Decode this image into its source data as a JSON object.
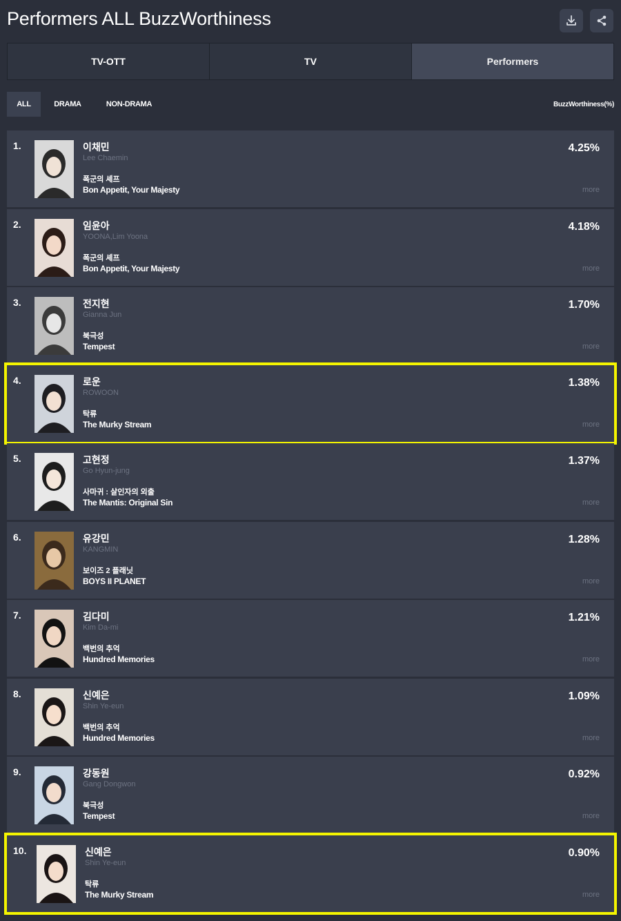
{
  "header": {
    "title": "Performers ALL BuzzWorthiness",
    "download_icon": "download-icon",
    "share_icon": "share-icon"
  },
  "tabs": [
    {
      "label": "TV-OTT",
      "active": false
    },
    {
      "label": "TV",
      "active": false
    },
    {
      "label": "Performers",
      "active": true
    }
  ],
  "filters": [
    {
      "label": "ALL",
      "active": true
    },
    {
      "label": "DRAMA",
      "active": false
    },
    {
      "label": "NON-DRAMA",
      "active": false
    }
  ],
  "column_label": "BuzzWorthiness(%)",
  "more_label": "more",
  "highlight_color": "#f5f500",
  "performers": [
    {
      "rank": "1.",
      "name_ko": "이채민",
      "name_en": "Lee Chaemin",
      "show_ko": "폭군의 셰프",
      "show_en": "Bon Appetit, Your Majesty",
      "pct": "4.25%",
      "highlighted": false
    },
    {
      "rank": "2.",
      "name_ko": "임윤아",
      "name_en": "YOONA,Lim Yoona",
      "show_ko": "폭군의 셰프",
      "show_en": "Bon Appetit, Your Majesty",
      "pct": "4.18%",
      "highlighted": false
    },
    {
      "rank": "3.",
      "name_ko": "전지현",
      "name_en": "Gianna Jun",
      "show_ko": "북극성",
      "show_en": "Tempest",
      "pct": "1.70%",
      "highlighted": false
    },
    {
      "rank": "4.",
      "name_ko": "로운",
      "name_en": "ROWOON",
      "show_ko": "탁류",
      "show_en": "The Murky Stream",
      "pct": "1.38%",
      "highlighted": true
    },
    {
      "rank": "5.",
      "name_ko": "고현정",
      "name_en": "Go Hyun-jung",
      "show_ko": "사마귀 : 살인자의 외출",
      "show_en": "The Mantis: Original Sin",
      "pct": "1.37%",
      "highlighted": false
    },
    {
      "rank": "6.",
      "name_ko": "유강민",
      "name_en": "KANGMIN",
      "show_ko": "보이즈 2 플래닛",
      "show_en": "BOYS II PLANET",
      "pct": "1.28%",
      "highlighted": false
    },
    {
      "rank": "7.",
      "name_ko": "김다미",
      "name_en": "Kim Da-mi",
      "show_ko": "백번의 추억",
      "show_en": "Hundred Memories",
      "pct": "1.21%",
      "highlighted": false
    },
    {
      "rank": "8.",
      "name_ko": "신예은",
      "name_en": "Shin Ye-eun",
      "show_ko": "백번의 추억",
      "show_en": "Hundred Memories",
      "pct": "1.09%",
      "highlighted": false
    },
    {
      "rank": "9.",
      "name_ko": "강동원",
      "name_en": "Gang Dongwon",
      "show_ko": "북극성",
      "show_en": "Tempest",
      "pct": "0.92%",
      "highlighted": false
    },
    {
      "rank": "10.",
      "name_ko": "신예은",
      "name_en": "Shin Ye-eun",
      "show_ko": "탁류",
      "show_en": "The Murky Stream",
      "pct": "0.90%",
      "highlighted": true
    }
  ]
}
